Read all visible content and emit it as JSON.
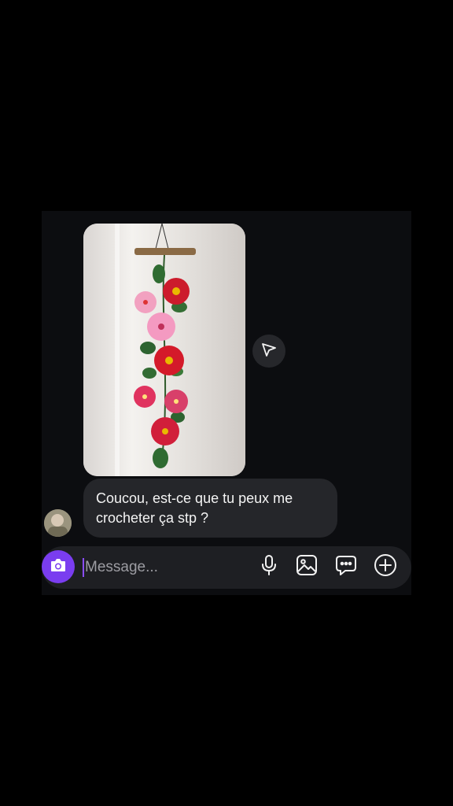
{
  "conversation": {
    "incoming_text": {
      "line1": "Coucou, est-ce que tu peux me",
      "line2": "crocheter ça stp ?"
    },
    "photo_icon": "photo-image",
    "share_icon": "send-arrow-icon"
  },
  "composer": {
    "placeholder": "Message...",
    "value": "",
    "accent_color": "#7a3df0",
    "tools": [
      "camera-icon",
      "microphone-icon",
      "gallery-icon",
      "sticker-icon",
      "plus-icon"
    ]
  }
}
